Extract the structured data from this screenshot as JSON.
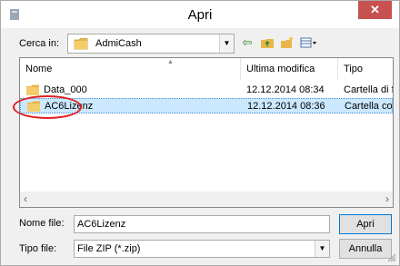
{
  "window": {
    "title": "Apri",
    "close_label": "✕"
  },
  "lookin": {
    "label": "Cerca in:",
    "value": "AdmiCash"
  },
  "columns": {
    "name": "Nome",
    "modified": "Ultima modifica",
    "type": "Tipo"
  },
  "files": [
    {
      "name": "Data_000",
      "modified": "12.12.2014 08:34",
      "type": "Cartella di fi"
    },
    {
      "name": "AC6Lizenz",
      "modified": "12.12.2014 08:36",
      "type": "Cartella con"
    }
  ],
  "filename": {
    "label": "Nome file:",
    "value": "AC6Lizenz"
  },
  "filetype": {
    "label": "Tipo file:",
    "value": "File ZIP (*.zip)"
  },
  "buttons": {
    "open": "Apri",
    "cancel": "Annulla"
  },
  "colors": {
    "selection": "#cce8ff",
    "highlight_oval": "#e02020",
    "close_button": "#c75050",
    "folder": "#e8b64c"
  }
}
